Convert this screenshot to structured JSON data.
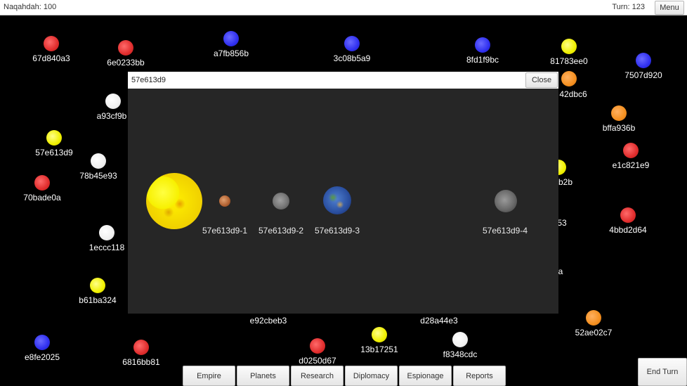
{
  "topbar": {
    "resource_label": "Naqahdah: 100",
    "turn_label": "Turn: 123",
    "menu_label": "Menu"
  },
  "stars": [
    {
      "id": "67d840a3",
      "color": "red"
    },
    {
      "id": "6e0233bb",
      "color": "red"
    },
    {
      "id": "a7fb856b",
      "color": "blue"
    },
    {
      "id": "3c08b5a9",
      "color": "blue"
    },
    {
      "id": "8fd1f9bc",
      "color": "blue"
    },
    {
      "id": "81783ee0",
      "color": "yellow"
    },
    {
      "id": "7507d920",
      "color": "blue"
    },
    {
      "id": "42dbc6",
      "color": "orange"
    },
    {
      "id": "a93cf9b",
      "color": "white"
    },
    {
      "id": "bffa936b",
      "color": "orange"
    },
    {
      "id": "57e613d9",
      "color": "yellow"
    },
    {
      "id": "e1c821e9",
      "color": "red"
    },
    {
      "id": "78b45e93",
      "color": "white"
    },
    {
      "id": "b2b",
      "color": "yellow"
    },
    {
      "id": "70bade0a",
      "color": "red"
    },
    {
      "id": "4bbd2d64",
      "color": "red"
    },
    {
      "id": "53",
      "color": "none"
    },
    {
      "id": "1eccc118",
      "color": "white"
    },
    {
      "id": "a",
      "color": "none"
    },
    {
      "id": "b61ba324",
      "color": "yellow"
    },
    {
      "id": "e92cbeb3",
      "color": "none"
    },
    {
      "id": "d28a44e3",
      "color": "white"
    },
    {
      "id": "52ae02c7",
      "color": "orange"
    },
    {
      "id": "13b17251",
      "color": "yellow"
    },
    {
      "id": "f8348cdc",
      "color": "white"
    },
    {
      "id": "e8fe2025",
      "color": "blue"
    },
    {
      "id": "6816bb81",
      "color": "red"
    },
    {
      "id": "d0250d67",
      "color": "red"
    }
  ],
  "system_dialog": {
    "title": "57e613d9",
    "close_label": "Close",
    "bodies": [
      {
        "name": "",
        "type": "star"
      },
      {
        "name": "57e613d9-1",
        "type": "rocky-red"
      },
      {
        "name": "57e613d9-2",
        "type": "rocky-gray"
      },
      {
        "name": "57e613d9-3",
        "type": "terran"
      },
      {
        "name": "57e613d9-4",
        "type": "rocky-gray"
      }
    ]
  },
  "bottom_nav": [
    "Empire",
    "Planets",
    "Research",
    "Diplomacy",
    "Espionage",
    "Reports"
  ],
  "end_turn_label": "End Turn"
}
